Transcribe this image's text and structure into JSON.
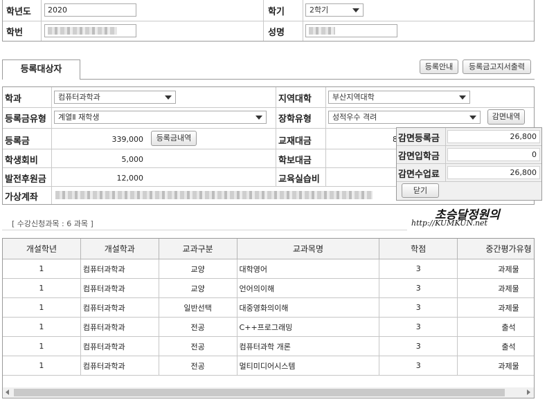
{
  "top": {
    "year_label": "학년도",
    "year_value": "2020",
    "term_label": "학기",
    "term_value": "2학기",
    "id_label": "학번",
    "name_label": "성명"
  },
  "tab": {
    "label": "등록대상자"
  },
  "buttons": {
    "guide": "등록안내",
    "print": "등록금고지서출력",
    "reduction_detail": "감면내역",
    "tuition_detail": "등록금내역",
    "close": "닫기"
  },
  "form": {
    "dept_label": "학과",
    "dept_value": "컴퓨터과학과",
    "region_label": "지역대학",
    "region_value": "부산지역대학",
    "fee_type_label": "등록금유형",
    "fee_type_value": "계열Ⅱ 재학생",
    "scholarship_label": "장학유형",
    "scholarship_value": "성적우수 격려",
    "tuition_label": "등록금",
    "tuition_value": "339,000",
    "textbook_label": "교재대금",
    "textbook_value": "8",
    "student_fee_label": "학생회비",
    "student_fee_value": "5,000",
    "newspaper_label": "학보대금",
    "newspaper_value": "",
    "dev_fund_label": "발전후원금",
    "dev_fund_value": "12,000",
    "practice_label": "교육실습비",
    "virtual_account_label": "가상계좌"
  },
  "reduction": {
    "rows": [
      {
        "label": "감면등록금",
        "value": "26,800"
      },
      {
        "label": "감면입학금",
        "value": "0"
      },
      {
        "label": "감면수업료",
        "value": "26,800"
      }
    ]
  },
  "course_count": "[ 수강신청과목 : 6 과목 ]",
  "watermark": {
    "line1": "초승달정원의",
    "line2": "http://KUMKUN.net"
  },
  "table": {
    "headers": [
      "개설학년",
      "개설학과",
      "교과구분",
      "교과목명",
      "학점",
      "중간평가유형"
    ],
    "rows": [
      [
        "1",
        "컴퓨터과학과",
        "교양",
        "대학영어",
        "3",
        "과제물"
      ],
      [
        "1",
        "컴퓨터과학과",
        "교양",
        "언어의이해",
        "3",
        "과제물"
      ],
      [
        "1",
        "컴퓨터과학과",
        "일반선택",
        "대중영화의이해",
        "3",
        "과제물"
      ],
      [
        "1",
        "컴퓨터과학과",
        "전공",
        "C++프로그래밍",
        "3",
        "출석"
      ],
      [
        "1",
        "컴퓨터과학과",
        "전공",
        "컴퓨터과학 개론",
        "3",
        "출석"
      ],
      [
        "1",
        "컴퓨터과학과",
        "전공",
        "멀티미디어시스템",
        "3",
        "과제물"
      ]
    ]
  }
}
